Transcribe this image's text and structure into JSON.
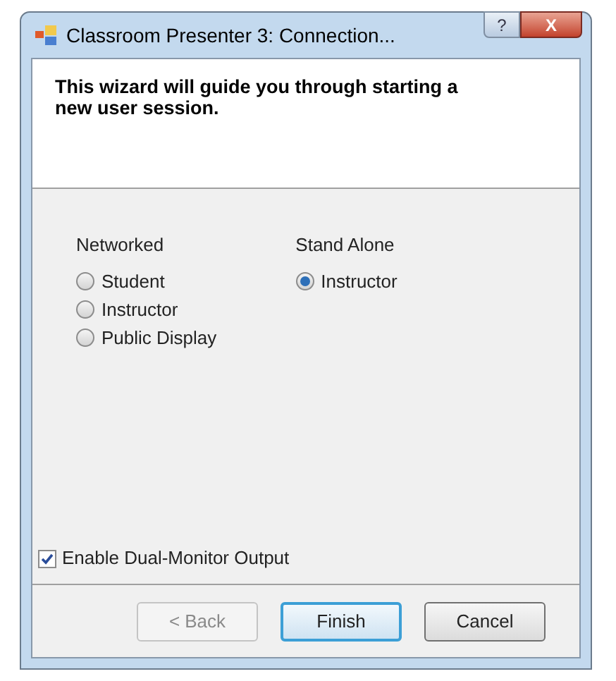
{
  "window": {
    "title": "Classroom Presenter 3: Connection...",
    "help_button": "?",
    "close_button": "X"
  },
  "header": {
    "text": "This wizard will guide you through starting a new user session."
  },
  "groups": [
    {
      "title": "Networked",
      "options": [
        {
          "label": "Student",
          "selected": false
        },
        {
          "label": "Instructor",
          "selected": false
        },
        {
          "label": "Public Display",
          "selected": false
        }
      ]
    },
    {
      "title": "Stand Alone",
      "options": [
        {
          "label": "Instructor",
          "selected": true
        }
      ]
    }
  ],
  "dual_monitor": {
    "label": "Enable Dual-Monitor Output",
    "checked": true
  },
  "buttons": [
    {
      "label": "< Back",
      "disabled": true,
      "default": false
    },
    {
      "label": "Finish",
      "disabled": false,
      "default": true
    },
    {
      "label": "Cancel",
      "disabled": false,
      "default": false
    }
  ]
}
